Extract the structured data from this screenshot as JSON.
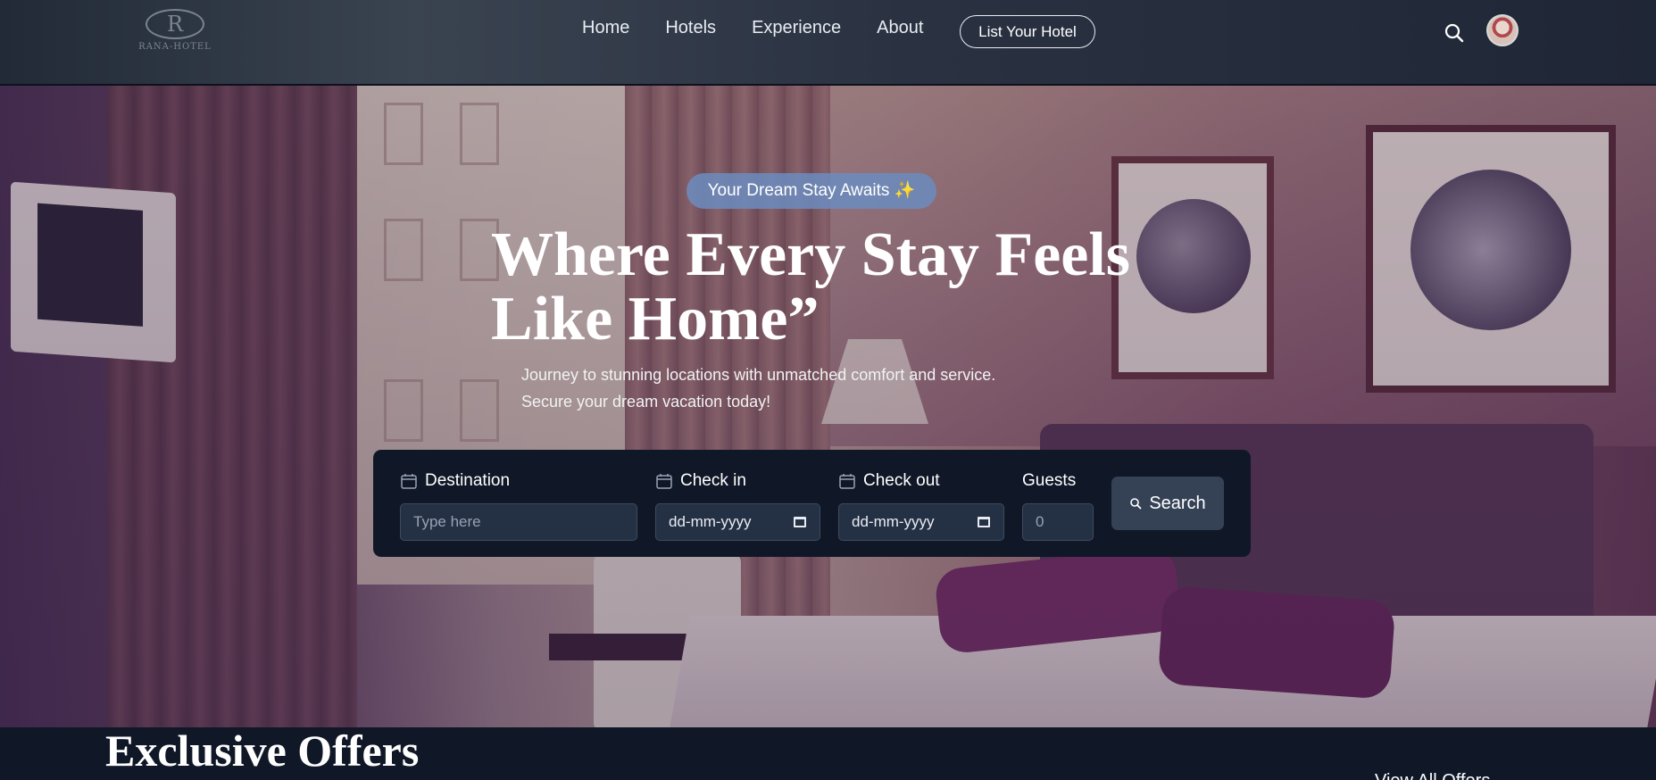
{
  "brand": {
    "logo_letter": "R",
    "logo_text": "RANA-HOTEL"
  },
  "nav": {
    "links": [
      "Home",
      "Hotels",
      "Experience",
      "About"
    ],
    "cta": "List Your Hotel"
  },
  "hero": {
    "badge": "Your Dream Stay Awaits ✨",
    "headline": "Where Every Stay Feels Like Home”",
    "subtext_line1": "Journey to stunning locations with unmatched comfort and service.",
    "subtext_line2": "Secure your dream vacation today!"
  },
  "search": {
    "destination_label": "Destination",
    "destination_placeholder": "Type here",
    "checkin_label": "Check in",
    "checkin_value": "dd-mm-yyyy",
    "checkout_label": "Check out",
    "checkout_value": "dd-mm-yyyy",
    "guests_label": "Guests",
    "guests_value": "0",
    "button_label": "Search"
  },
  "offers": {
    "title": "Exclusive Offers",
    "view_all": "View All Offers"
  },
  "colors": {
    "panel": "#101828",
    "input_bg": "#243043",
    "button_bg": "#354256",
    "badge_bg": "#6c8cbe"
  },
  "icons": [
    "search-icon",
    "calendar-icon",
    "avatar",
    "date-picker-icon"
  ]
}
